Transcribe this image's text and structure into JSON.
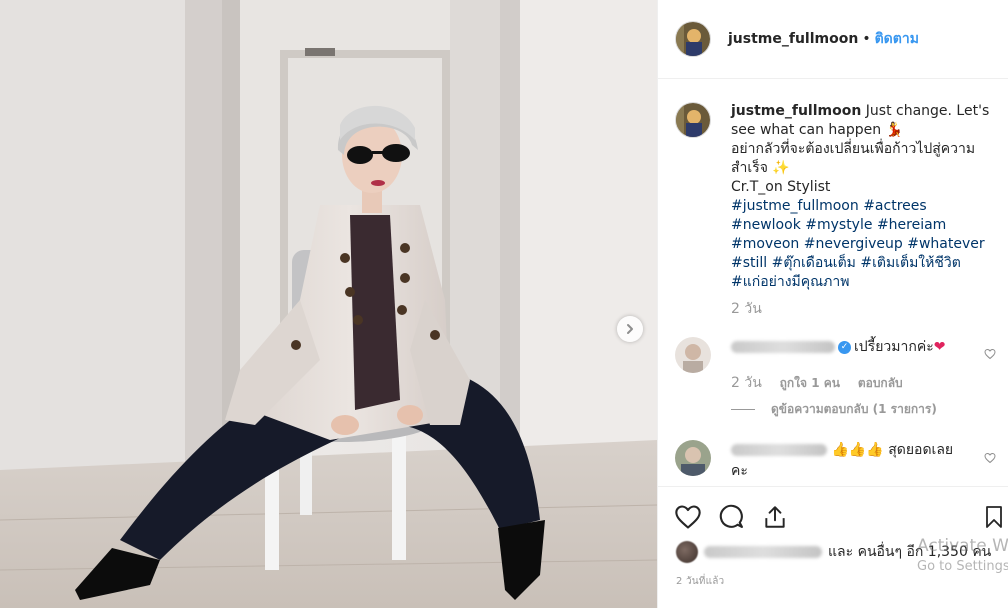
{
  "post": {
    "username": "justme_fullmoon",
    "follow_label": "ติดตาม",
    "separator": "•"
  },
  "caption": {
    "username": "justme_fullmoon",
    "text_en": " Just change. Let's see what can happen ",
    "line_th1": "อย่ากลัวที่จะต้องเปลี่ยนเพื่อก้าวไปสู่ความสำเร็จ ",
    "credit": "Cr.T_on Stylist",
    "hashtags": [
      "#justme_fullmoon",
      "#actrees",
      "#newlook",
      "#mystyle",
      "#hereiam",
      "#moveon",
      "#nevergiveup",
      "#whatever",
      "#still",
      "#ตุ๊กเดือนเต็ม",
      "#เติมเต็มให้ชีวิต",
      "#แก่อย่างมีคุณภาพ"
    ],
    "time": "2 วัน"
  },
  "comments": [
    {
      "text": "เปรี้ยวมากค่ะ",
      "time": "2 วัน",
      "likes": "ถูกใจ 1 คน",
      "reply": "ตอบกลับ",
      "view_replies": "ดูข้อความตอบกลับ (1 รายการ)"
    },
    {
      "emoji": "👍👍👍",
      "text": " สุดยอดเลยคะ"
    }
  ],
  "actions": {
    "liked_by_suffix": "และ คนอื่นๆ อีก 1,350 คน",
    "post_time": "2 วันที่แล้ว"
  },
  "watermark": {
    "line1": "Activate W",
    "line2": "Go to Settings"
  },
  "icons": {
    "like": "heart-icon",
    "comment": "comment-icon",
    "share": "share-icon",
    "save": "bookmark-icon",
    "next": "chevron-right-icon"
  },
  "colors": {
    "link": "#003569",
    "follow": "#3897f0",
    "muted": "#999999"
  }
}
